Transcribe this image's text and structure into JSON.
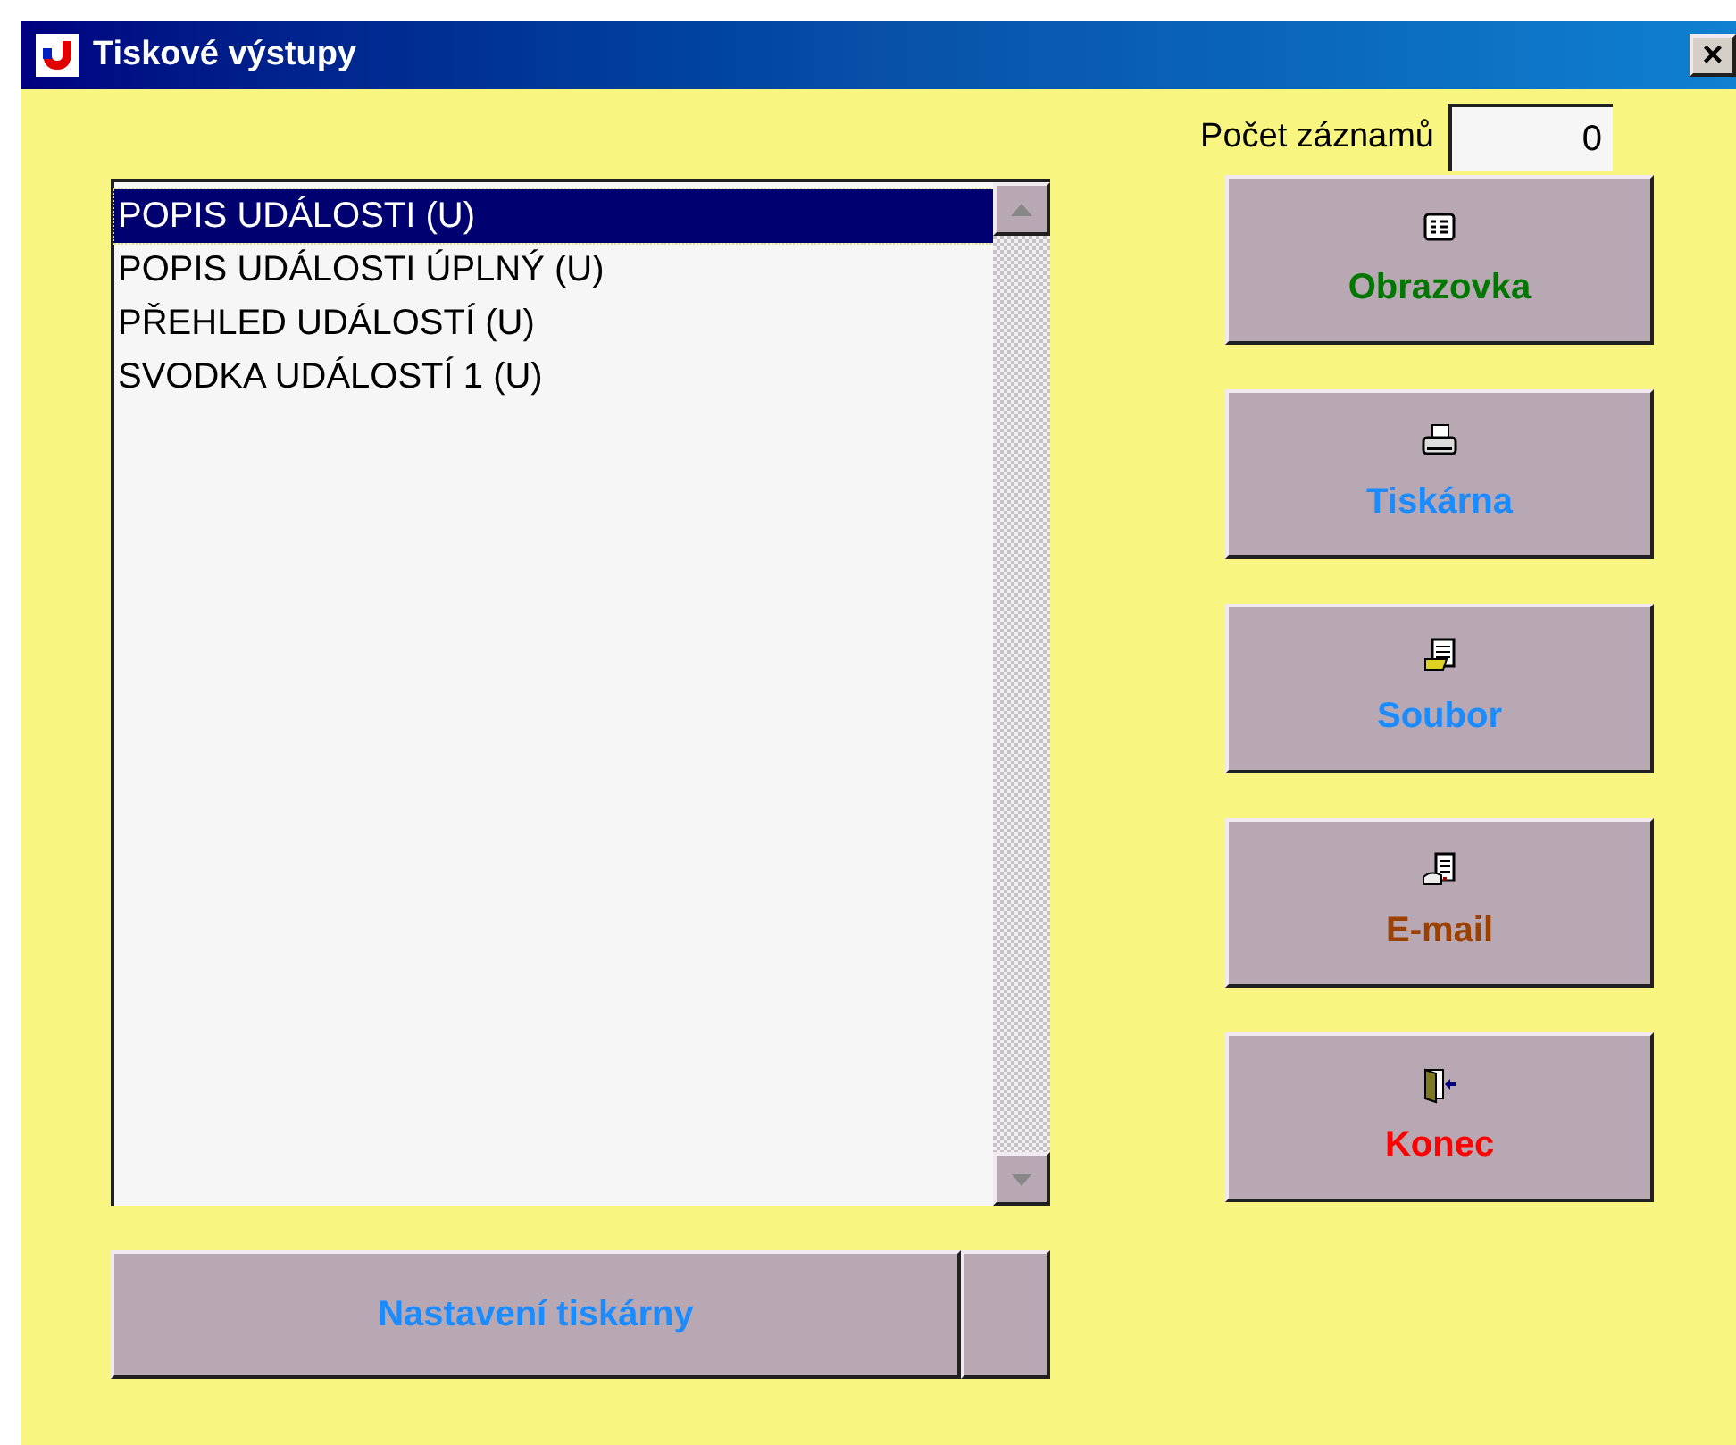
{
  "window": {
    "title": "Tiskové výstupy",
    "close": "×"
  },
  "record_count": {
    "label": "Počet záznamů",
    "value": "0"
  },
  "report_list": {
    "items": [
      {
        "label": "POPIS UDÁLOSTI (U)",
        "selected": true
      },
      {
        "label": "POPIS UDÁLOSTI ÚPLNÝ (U)",
        "selected": false
      },
      {
        "label": "PŘEHLED UDÁLOSTÍ (U)",
        "selected": false
      },
      {
        "label": "SVODKA UDÁLOSTÍ 1 (U)",
        "selected": false
      }
    ]
  },
  "output_buttons": [
    {
      "label": "Obrazovka",
      "kind": "screen",
      "color": "#007800"
    },
    {
      "label": "Tiskárna",
      "kind": "printer",
      "color": "#1a8cff"
    },
    {
      "label": "Soubor",
      "kind": "file",
      "color": "#1a8cff"
    },
    {
      "label": "E-mail",
      "kind": "email",
      "color": "#9c4000"
    },
    {
      "label": "Konec",
      "kind": "exit",
      "color": "#ff0000"
    }
  ],
  "printer_setup": {
    "label": "Nastavení tiskárny"
  }
}
